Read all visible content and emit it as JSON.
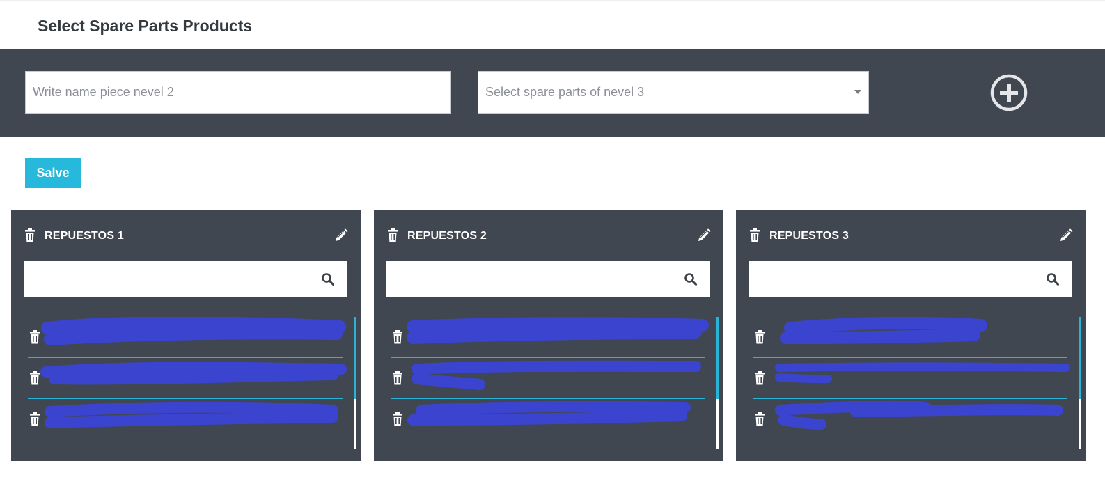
{
  "page": {
    "title": "Select Spare Parts Products"
  },
  "toolbar": {
    "name_input": {
      "placeholder": "Write name piece nevel 2",
      "value": ""
    },
    "spare_parts_select": {
      "placeholder": "Select spare parts of nevel 3"
    },
    "add_icon": "plus-circle-icon"
  },
  "actions": {
    "save_label": "Salve"
  },
  "colors": {
    "header_bar": "#414750",
    "panel_bg": "#414750",
    "accent": "#26b9db",
    "redaction": "#3b44cf"
  },
  "panels": [
    {
      "title": "REPUESTOS 1",
      "items": [
        {
          "text": ""
        },
        {
          "text": ""
        },
        {
          "text": ""
        }
      ]
    },
    {
      "title": "REPUESTOS 2",
      "items": [
        {
          "text": ""
        },
        {
          "text": ""
        },
        {
          "text": ""
        }
      ]
    },
    {
      "title": "REPUESTOS 3",
      "items": [
        {
          "text": ""
        },
        {
          "text": ""
        },
        {
          "text": ""
        }
      ]
    }
  ]
}
